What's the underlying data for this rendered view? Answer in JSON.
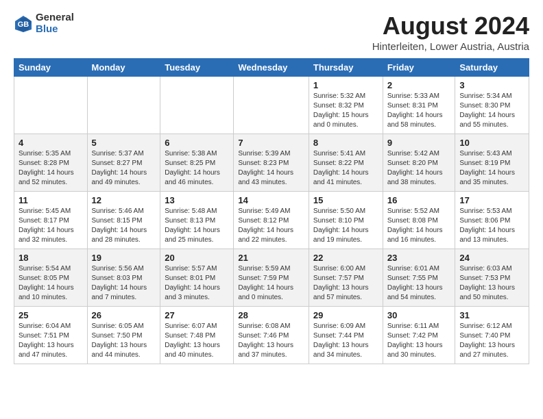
{
  "header": {
    "logo_general": "General",
    "logo_blue": "Blue",
    "month_title": "August 2024",
    "location": "Hinterleiten, Lower Austria, Austria"
  },
  "weekdays": [
    "Sunday",
    "Monday",
    "Tuesday",
    "Wednesday",
    "Thursday",
    "Friday",
    "Saturday"
  ],
  "weeks": [
    [
      {
        "day": "",
        "info": ""
      },
      {
        "day": "",
        "info": ""
      },
      {
        "day": "",
        "info": ""
      },
      {
        "day": "",
        "info": ""
      },
      {
        "day": "1",
        "info": "Sunrise: 5:32 AM\nSunset: 8:32 PM\nDaylight: 15 hours and 0 minutes."
      },
      {
        "day": "2",
        "info": "Sunrise: 5:33 AM\nSunset: 8:31 PM\nDaylight: 14 hours and 58 minutes."
      },
      {
        "day": "3",
        "info": "Sunrise: 5:34 AM\nSunset: 8:30 PM\nDaylight: 14 hours and 55 minutes."
      }
    ],
    [
      {
        "day": "4",
        "info": "Sunrise: 5:35 AM\nSunset: 8:28 PM\nDaylight: 14 hours and 52 minutes."
      },
      {
        "day": "5",
        "info": "Sunrise: 5:37 AM\nSunset: 8:27 PM\nDaylight: 14 hours and 49 minutes."
      },
      {
        "day": "6",
        "info": "Sunrise: 5:38 AM\nSunset: 8:25 PM\nDaylight: 14 hours and 46 minutes."
      },
      {
        "day": "7",
        "info": "Sunrise: 5:39 AM\nSunset: 8:23 PM\nDaylight: 14 hours and 43 minutes."
      },
      {
        "day": "8",
        "info": "Sunrise: 5:41 AM\nSunset: 8:22 PM\nDaylight: 14 hours and 41 minutes."
      },
      {
        "day": "9",
        "info": "Sunrise: 5:42 AM\nSunset: 8:20 PM\nDaylight: 14 hours and 38 minutes."
      },
      {
        "day": "10",
        "info": "Sunrise: 5:43 AM\nSunset: 8:19 PM\nDaylight: 14 hours and 35 minutes."
      }
    ],
    [
      {
        "day": "11",
        "info": "Sunrise: 5:45 AM\nSunset: 8:17 PM\nDaylight: 14 hours and 32 minutes."
      },
      {
        "day": "12",
        "info": "Sunrise: 5:46 AM\nSunset: 8:15 PM\nDaylight: 14 hours and 28 minutes."
      },
      {
        "day": "13",
        "info": "Sunrise: 5:48 AM\nSunset: 8:13 PM\nDaylight: 14 hours and 25 minutes."
      },
      {
        "day": "14",
        "info": "Sunrise: 5:49 AM\nSunset: 8:12 PM\nDaylight: 14 hours and 22 minutes."
      },
      {
        "day": "15",
        "info": "Sunrise: 5:50 AM\nSunset: 8:10 PM\nDaylight: 14 hours and 19 minutes."
      },
      {
        "day": "16",
        "info": "Sunrise: 5:52 AM\nSunset: 8:08 PM\nDaylight: 14 hours and 16 minutes."
      },
      {
        "day": "17",
        "info": "Sunrise: 5:53 AM\nSunset: 8:06 PM\nDaylight: 14 hours and 13 minutes."
      }
    ],
    [
      {
        "day": "18",
        "info": "Sunrise: 5:54 AM\nSunset: 8:05 PM\nDaylight: 14 hours and 10 minutes."
      },
      {
        "day": "19",
        "info": "Sunrise: 5:56 AM\nSunset: 8:03 PM\nDaylight: 14 hours and 7 minutes."
      },
      {
        "day": "20",
        "info": "Sunrise: 5:57 AM\nSunset: 8:01 PM\nDaylight: 14 hours and 3 minutes."
      },
      {
        "day": "21",
        "info": "Sunrise: 5:59 AM\nSunset: 7:59 PM\nDaylight: 14 hours and 0 minutes."
      },
      {
        "day": "22",
        "info": "Sunrise: 6:00 AM\nSunset: 7:57 PM\nDaylight: 13 hours and 57 minutes."
      },
      {
        "day": "23",
        "info": "Sunrise: 6:01 AM\nSunset: 7:55 PM\nDaylight: 13 hours and 54 minutes."
      },
      {
        "day": "24",
        "info": "Sunrise: 6:03 AM\nSunset: 7:53 PM\nDaylight: 13 hours and 50 minutes."
      }
    ],
    [
      {
        "day": "25",
        "info": "Sunrise: 6:04 AM\nSunset: 7:51 PM\nDaylight: 13 hours and 47 minutes."
      },
      {
        "day": "26",
        "info": "Sunrise: 6:05 AM\nSunset: 7:50 PM\nDaylight: 13 hours and 44 minutes."
      },
      {
        "day": "27",
        "info": "Sunrise: 6:07 AM\nSunset: 7:48 PM\nDaylight: 13 hours and 40 minutes."
      },
      {
        "day": "28",
        "info": "Sunrise: 6:08 AM\nSunset: 7:46 PM\nDaylight: 13 hours and 37 minutes."
      },
      {
        "day": "29",
        "info": "Sunrise: 6:09 AM\nSunset: 7:44 PM\nDaylight: 13 hours and 34 minutes."
      },
      {
        "day": "30",
        "info": "Sunrise: 6:11 AM\nSunset: 7:42 PM\nDaylight: 13 hours and 30 minutes."
      },
      {
        "day": "31",
        "info": "Sunrise: 6:12 AM\nSunset: 7:40 PM\nDaylight: 13 hours and 27 minutes."
      }
    ]
  ]
}
